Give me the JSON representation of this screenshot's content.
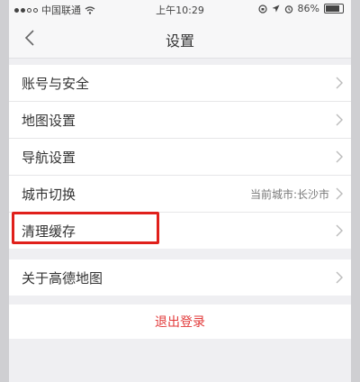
{
  "status_bar": {
    "carrier": "中国联通",
    "time": "上午10:29",
    "battery": "86%",
    "battery_level": 0.86
  },
  "nav": {
    "title": "设置",
    "back_icon": "chevron-left-icon"
  },
  "settings": {
    "group1": [
      {
        "label": "账号与安全",
        "value": ""
      },
      {
        "label": "地图设置",
        "value": ""
      },
      {
        "label": "导航设置",
        "value": ""
      },
      {
        "label": "城市切换",
        "value": "当前城市:长沙市"
      },
      {
        "label": "清理缓存",
        "value": ""
      }
    ],
    "group2": [
      {
        "label": "关于高德地图",
        "value": ""
      }
    ]
  },
  "logout_label": "退出登录",
  "colors": {
    "accent_red": "#e23a3a",
    "highlight_border": "#e0201b"
  }
}
